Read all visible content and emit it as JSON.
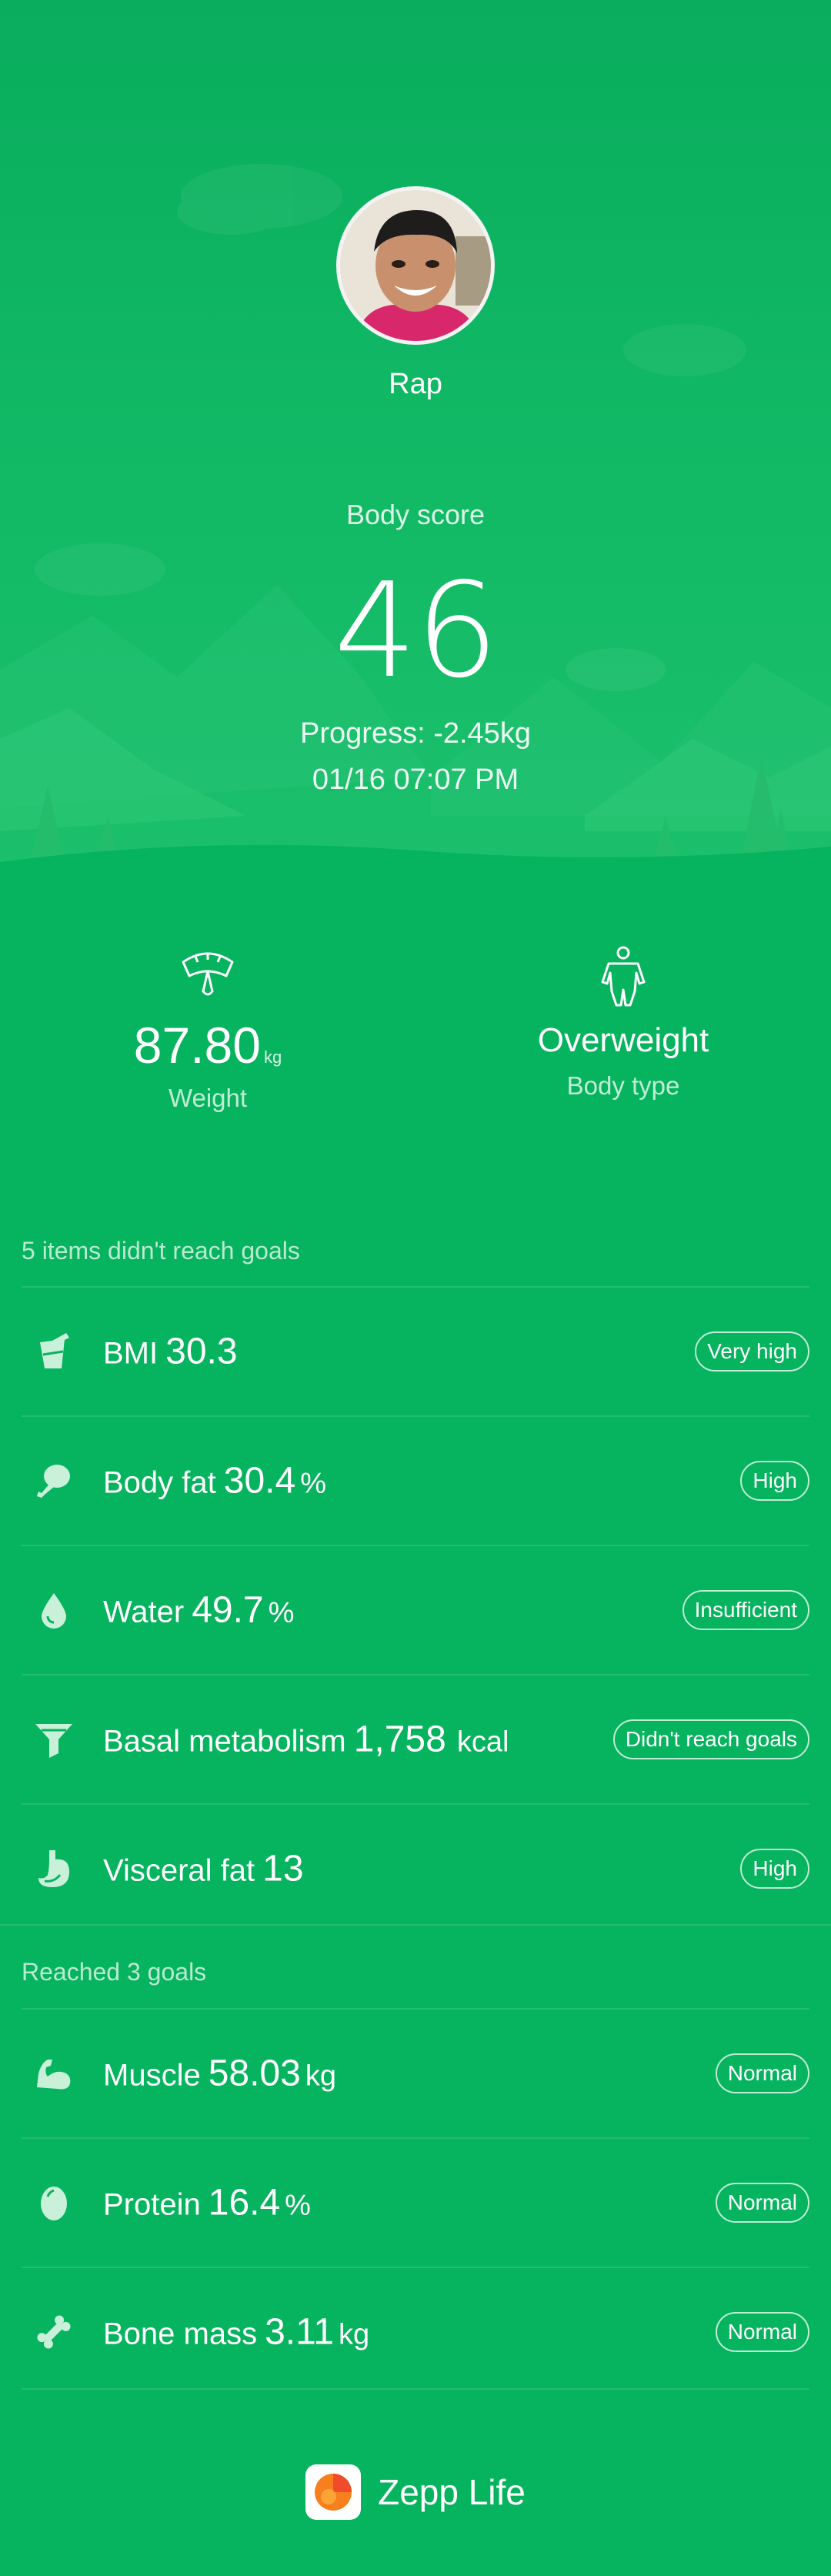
{
  "profile": {
    "name": "Rap"
  },
  "score": {
    "label": "Body score",
    "value": "46",
    "progress": "Progress: -2.45kg",
    "timestamp": "01/16 07:07 PM"
  },
  "summary": {
    "weight": {
      "value": "87.80",
      "unit": "kg",
      "label": "Weight",
      "icon": "scale-icon"
    },
    "body_type": {
      "value": "Overweight",
      "label": "Body type",
      "icon": "body-figure-icon"
    }
  },
  "not_reached": {
    "title": "5 items didn't reach goals",
    "items": [
      {
        "name": "BMI",
        "value": "30.3",
        "unit": "",
        "status": "Very high",
        "icon": "bmi-cup-icon"
      },
      {
        "name": "Body fat",
        "value": "30.4",
        "unit": "%",
        "status": "High",
        "icon": "drumstick-icon"
      },
      {
        "name": "Water",
        "value": "49.7",
        "unit": "%",
        "status": "Insufficient",
        "icon": "water-drop-icon"
      },
      {
        "name": "Basal metabolism",
        "value": "1,758",
        "unit": "kcal",
        "status": "Didn't reach goals",
        "icon": "funnel-icon"
      },
      {
        "name": "Visceral fat",
        "value": "13",
        "unit": "",
        "status": "High",
        "icon": "stomach-icon"
      }
    ]
  },
  "reached": {
    "title": "Reached 3 goals",
    "items": [
      {
        "name": "Muscle",
        "value": "58.03",
        "unit": "kg",
        "status": "Normal",
        "icon": "flexed-arm-icon"
      },
      {
        "name": "Protein",
        "value": "16.4",
        "unit": "%",
        "status": "Normal",
        "icon": "egg-icon"
      },
      {
        "name": "Bone mass",
        "value": "3.11",
        "unit": "kg",
        "status": "Normal",
        "icon": "bone-icon"
      }
    ]
  },
  "footer": {
    "brand": "Zepp Life"
  },
  "colors": {
    "background": "#06b35e",
    "hero_top": "#09ad5d",
    "icon_tint": "#c9f0d9",
    "logo_orange": "#f77f1e"
  }
}
